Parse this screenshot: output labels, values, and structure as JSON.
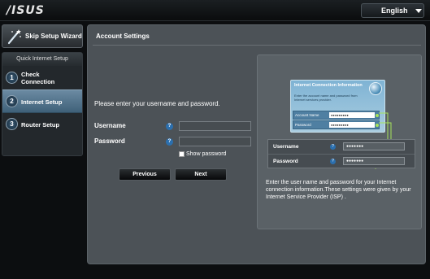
{
  "header": {
    "logo": "/ISUS",
    "language": "English"
  },
  "sidebar": {
    "wizard_label": "Skip Setup Wizard",
    "section_title": "Quick Internet Setup",
    "steps": [
      {
        "num": "1",
        "label_line1": "Check",
        "label_line2": "Connection"
      },
      {
        "num": "2",
        "label_line1": "Internet Setup",
        "label_line2": ""
      },
      {
        "num": "3",
        "label_line1": "Router Setup",
        "label_line2": ""
      }
    ]
  },
  "main": {
    "title": "Account Settings",
    "instruction": "Please enter your username and password.",
    "username_label": "Username",
    "password_label": "Password",
    "username_value": "",
    "password_value": "",
    "help_glyph": "?",
    "show_password_label": "Show password",
    "previous_label": "Previous",
    "next_label": "Next"
  },
  "help": {
    "card_title": "Internet Connection Information",
    "card_subtitle": "Enter the account name and password from Internet services provider.",
    "card_account_label": "Account Name",
    "card_password_label": "Password",
    "card_masked": "●●●●●●●●●",
    "zoom_username_label": "Username",
    "zoom_password_label": "Password",
    "zoom_masked": "●●●●●●●",
    "text": "Enter the user name and password for your Internet connection information.These settings were given by your Internet Service Provider (ISP) ."
  },
  "colors": {
    "accent_blue": "#2b6fae",
    "active_step": "#6b8aa2",
    "connector_green": "#a6e35a"
  },
  "icons": {
    "wizard": "magic-wand-icon",
    "help": "question-mark-icon",
    "language": "chevron-down-icon",
    "globe": "globe-icon"
  }
}
